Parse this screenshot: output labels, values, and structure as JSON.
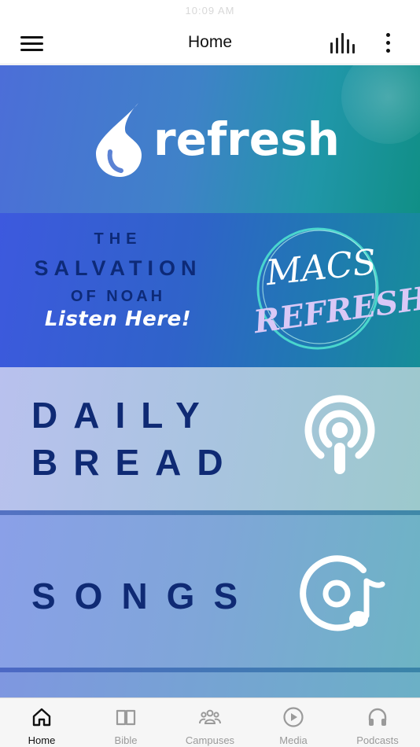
{
  "status_bar": {
    "time": "10:09 AM"
  },
  "header": {
    "title": "Home"
  },
  "banners": {
    "refresh": {
      "word": "refresh"
    },
    "salvation": {
      "line1": "THE",
      "line2": "SALVATION",
      "line3": "OF NOAH",
      "cta": "Listen Here!",
      "seal_line1": "MACS",
      "seal_line2": "REFRESH"
    },
    "daily": {
      "line1": "DAILY",
      "line2": "BREAD"
    },
    "songs": {
      "title": "SONGS"
    }
  },
  "tabs": [
    {
      "label": "Home",
      "icon": "home-icon",
      "active": true
    },
    {
      "label": "Bible",
      "icon": "book-icon",
      "active": false
    },
    {
      "label": "Campuses",
      "icon": "people-icon",
      "active": false
    },
    {
      "label": "Media",
      "icon": "play-circle-icon",
      "active": false
    },
    {
      "label": "Podcasts",
      "icon": "headphones-icon",
      "active": false
    }
  ],
  "colors": {
    "accent_dark_blue": "#0f2a74",
    "tab_active": "#111111",
    "tab_inactive": "#9a9a9a"
  }
}
